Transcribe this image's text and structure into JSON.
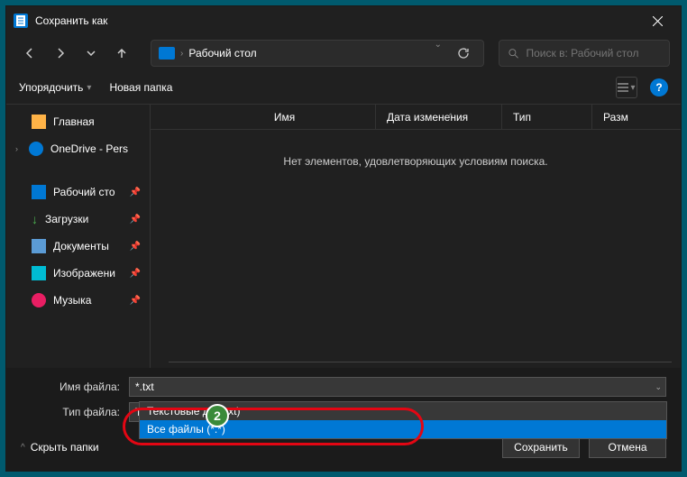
{
  "title": "Сохранить как",
  "nav": {
    "location": "Рабочий стол"
  },
  "search": {
    "placeholder": "Поиск в: Рабочий стол"
  },
  "toolbar": {
    "organize": "Упорядочить",
    "newfolder": "Новая папка"
  },
  "sidebar": {
    "items": [
      {
        "label": "Главная"
      },
      {
        "label": "OneDrive - Pers"
      },
      {
        "label": "Рабочий сто"
      },
      {
        "label": "Загрузки"
      },
      {
        "label": "Документы"
      },
      {
        "label": "Изображени"
      },
      {
        "label": "Музыка"
      }
    ]
  },
  "columns": {
    "name": "Имя",
    "date": "Дата изменения",
    "type": "Тип",
    "size": "Разм"
  },
  "empty": "Нет элементов, удовлетворяющих условиям поиска.",
  "filename": {
    "label": "Имя файла:",
    "value": "*.txt"
  },
  "filetype": {
    "label": "Тип файла:",
    "value": "Текстовые докум           (*.txt)"
  },
  "options": [
    {
      "label": "Текстовые доку               xt)"
    },
    {
      "label": "Все файлы  (*.*)"
    }
  ],
  "hide": "Скрыть папки",
  "buttons": {
    "save": "Сохранить",
    "cancel": "Отмена"
  },
  "badge": "2"
}
